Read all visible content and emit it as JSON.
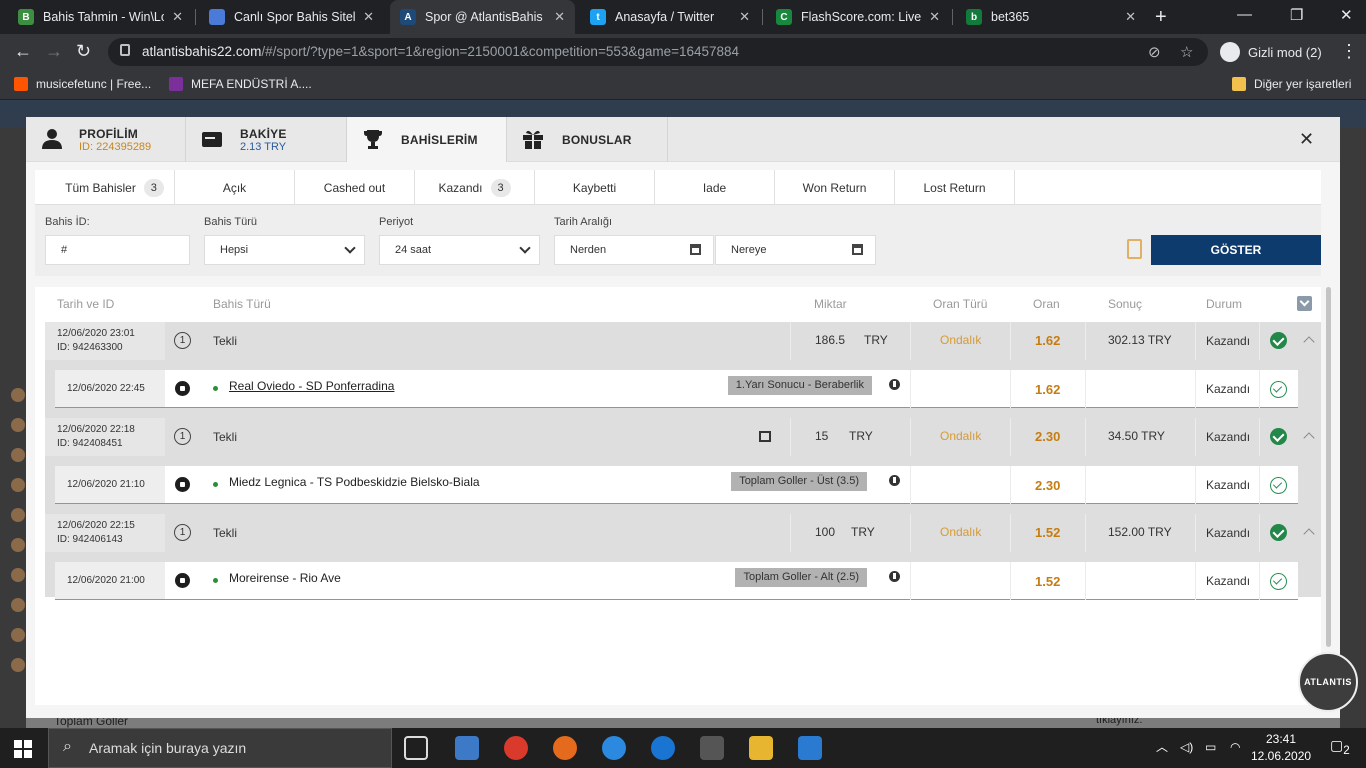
{
  "browser": {
    "tabs": [
      {
        "title": "Bahis Tahmin - Win\\Los",
        "fav": "B",
        "color": "#3e8e41"
      },
      {
        "title": "Canlı Spor Bahis Siteleri",
        "fav": "",
        "color": "#4a7bd8"
      },
      {
        "title": "Spor @ AtlantisBahis | S",
        "fav": "A",
        "color": "#1e4a7a"
      },
      {
        "title": "Anasayfa / Twitter",
        "fav": "t",
        "color": "#1da1f2"
      },
      {
        "title": "FlashScore.com: Live Fo",
        "fav": "C",
        "color": "#18883f"
      },
      {
        "title": "bet365",
        "fav": "b",
        "color": "#127a3b"
      }
    ],
    "url_host": "atlantisbahis22.com",
    "url_path": "/#/sport/?type=1&sport=1&region=2150001&competition=553&game=16457884",
    "incognito_label": "Gizli mod (2)",
    "bookmarks": [
      {
        "label": "musicefetunc | Free...",
        "color": "#ff5500"
      },
      {
        "label": "MEFA ENDÜSTRİ A....",
        "color": "#7a2f9a"
      }
    ],
    "other_bookmarks": "Diğer yer işaretleri"
  },
  "modal": {
    "tabs": {
      "profile": {
        "title": "PROFİLİM",
        "sub": "ID: 224395289"
      },
      "balance": {
        "title": "BAKİYE",
        "sub": "2.13 TRY"
      },
      "bets": {
        "title": "BAHİSLERİM"
      },
      "bonus": {
        "title": "BONUSLAR"
      }
    },
    "close": "✕"
  },
  "filters": {
    "tabs": [
      {
        "label": "Tüm Bahisler",
        "count": "3"
      },
      {
        "label": "Açık",
        "count": ""
      },
      {
        "label": "Cashed out",
        "count": ""
      },
      {
        "label": "Kazandı",
        "count": "3"
      },
      {
        "label": "Kaybetti",
        "count": ""
      },
      {
        "label": "Iade",
        "count": ""
      },
      {
        "label": "Won Return",
        "count": ""
      },
      {
        "label": "Lost Return",
        "count": ""
      }
    ],
    "labels": {
      "bet_id": "Bahis İD:",
      "bet_type": "Bahis Türü",
      "period": "Periyot",
      "date_range": "Tarih Aralığı"
    },
    "values": {
      "bet_id": "#",
      "bet_type": "Hepsi",
      "period": "24 saat",
      "from": "Nerden",
      "to": "Nereye"
    },
    "show_button": "GÖSTER"
  },
  "table": {
    "headers": {
      "date": "Tarih ve ID",
      "type": "Bahis Türü",
      "amount": "Miktar",
      "odd_type": "Oran Türü",
      "odd": "Oran",
      "result": "Sonuç",
      "status": "Durum"
    },
    "bets": [
      {
        "date": "12/06/2020 23:01",
        "id": "ID: 942463300",
        "type": "Tekli",
        "amount": "186.5",
        "currency": "TRY",
        "odd_type": "Ondalık",
        "odd": "1.62",
        "result": "302.13 TRY",
        "status": "Kazandı",
        "gift": false,
        "selection": {
          "date": "12/06/2020 22:45",
          "event": "Real Oviedo - SD Ponferradina",
          "market": "1.Yarı Sonucu - Beraberlik",
          "odd": "1.62",
          "status": "Kazandı",
          "underline": true
        }
      },
      {
        "date": "12/06/2020 22:18",
        "id": "ID: 942408451",
        "type": "Tekli",
        "amount": "15",
        "currency": "TRY",
        "odd_type": "Ondalık",
        "odd": "2.30",
        "result": "34.50 TRY",
        "status": "Kazandı",
        "gift": true,
        "selection": {
          "date": "12/06/2020 21:10",
          "event": "Miedz Legnica - TS Podbeskidzie Bielsko-Biala",
          "market": "Toplam Goller - Üst (3.5)",
          "odd": "2.30",
          "status": "Kazandı",
          "underline": false
        }
      },
      {
        "date": "12/06/2020 22:15",
        "id": "ID: 942406143",
        "type": "Tekli",
        "amount": "100",
        "currency": "TRY",
        "odd_type": "Ondalık",
        "odd": "1.52",
        "result": "152.00 TRY",
        "status": "Kazandı",
        "gift": false,
        "selection": {
          "date": "12/06/2020 21:00",
          "event": "Moreirense - Rio Ave",
          "market": "Toplam Goller - Alt (2.5)",
          "odd": "1.52",
          "status": "Kazandı",
          "underline": false
        }
      }
    ]
  },
  "page": {
    "bottom_left": "Toplam Goller",
    "bottom_right": "tıklayınız.",
    "logo": "ATLANTIS"
  },
  "taskbar": {
    "search_placeholder": "Aramak için buraya yazın",
    "time": "23:41",
    "date": "12.06.2020",
    "notifications": "2"
  }
}
